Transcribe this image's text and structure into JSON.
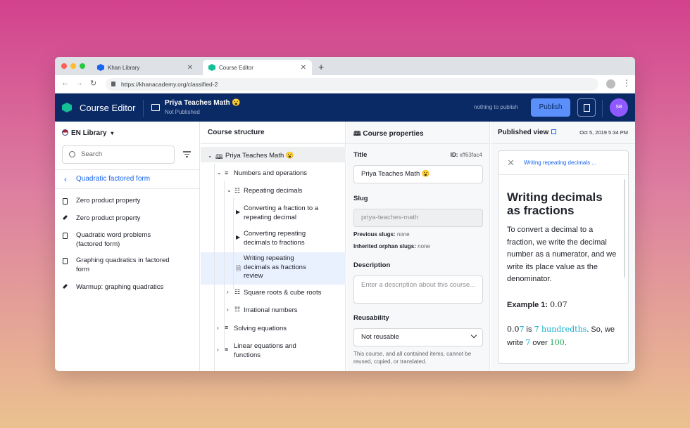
{
  "browser": {
    "tabs": [
      {
        "label": "Khan Library"
      },
      {
        "label": "Course Editor"
      }
    ],
    "url": "https://khanacademy.org/classified-2"
  },
  "header": {
    "app_title": "Course Editor",
    "course_name": "Priya Teaches Math 😮",
    "course_status": "Not Published",
    "nothing_to_publish": "nothing to publish",
    "publish_label": "Publish",
    "avatar_initials": "SB"
  },
  "library": {
    "title": "EN Library",
    "search_placeholder": "Search",
    "breadcrumb": "Quadratic factored form",
    "items": [
      {
        "label": "Zero product property",
        "icon": "document-icon"
      },
      {
        "label": "Zero product property",
        "icon": "pencil-icon"
      },
      {
        "label": "Quadratic word problems (factored form)",
        "icon": "document-icon"
      },
      {
        "label": "Graphing quadratics in factored form",
        "icon": "document-icon"
      },
      {
        "label": "Warmup: graphing quadratics",
        "icon": "pencil-icon"
      }
    ]
  },
  "structure": {
    "title": "Course structure",
    "root": "Priya Teaches Math 😮",
    "nodes": [
      {
        "label": "Numbers and operations"
      },
      {
        "label": "Repeating decimals"
      },
      {
        "label": "Converting a fraction to a repeating decimal"
      },
      {
        "label": "Converting repeating decimals to fractions"
      },
      {
        "label": "Writing repeating decimals as fractions review"
      },
      {
        "label": "Square roots & cube roots"
      },
      {
        "label": "Irrational numbers"
      },
      {
        "label": "Solving equations"
      },
      {
        "label": "Linear equations and functions"
      }
    ]
  },
  "properties": {
    "title": "Course properties",
    "title_label": "Title",
    "id_label": "ID:",
    "id_value": "xff63fac4",
    "title_value": "Priya Teaches Math 😮",
    "slug_label": "Slug",
    "slug_value": "priya-teaches-math",
    "previous_slugs_label": "Previous slugs:",
    "previous_slugs_value": "none",
    "orphan_slugs_label": "Inherited orphan slugs:",
    "orphan_slugs_value": "none",
    "description_label": "Description",
    "description_placeholder": "Enter a description about this course...",
    "reusability_label": "Reusability",
    "reusability_value": "Not reusable",
    "reusability_note": "This course, and all contained items, cannot be reused, copied, or translated."
  },
  "published": {
    "title": "Published view",
    "date": "Oct 5, 2019 5:34 PM",
    "card_link": "Writing repeating decimals ...",
    "article_title": "Writing decimals as fractions",
    "paragraph": "To convert a decimal to a fraction, we write the decimal number as a numerator, and we write its place value as the denominator.",
    "example_label": "Example 1:",
    "example_value": "0.07",
    "line_a1": "0.0",
    "line_a2": "7",
    "line_a3": " is ",
    "line_a4": "7 hundredths",
    "line_a5": ". So, we",
    "line_b1": "write ",
    "line_b2": "7",
    "line_b3": " over ",
    "line_b4": "100",
    "line_b5": "."
  }
}
